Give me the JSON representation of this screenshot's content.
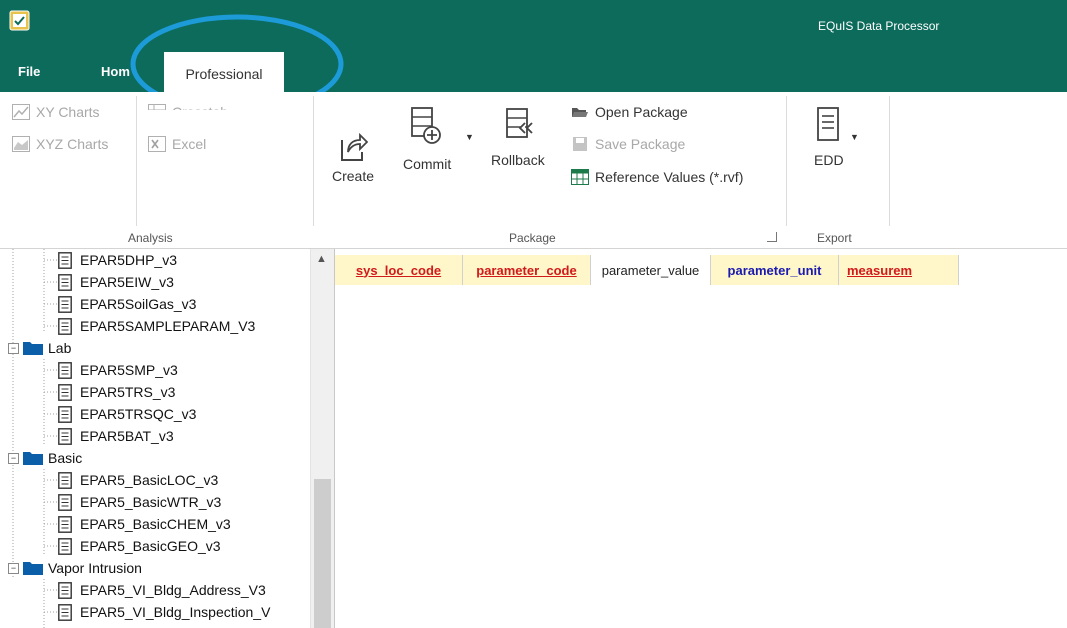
{
  "app": {
    "title": "EQuIS Data Processor"
  },
  "tabs": {
    "file": "File",
    "home": "Hom",
    "professional": "Professional"
  },
  "ribbon": {
    "analysis": {
      "label": "Analysis",
      "xy_charts": "XY Charts",
      "xyz_charts": "XYZ Charts",
      "crosstab": "Crosstab",
      "excel": "Excel"
    },
    "package": {
      "label": "Package",
      "create": "Create",
      "commit": "Commit",
      "rollback": "Rollback",
      "open_package": "Open Package",
      "save_package": "Save Package",
      "reference_values": "Reference Values (*.rvf)"
    },
    "export": {
      "label": "Export",
      "edd": "EDD"
    }
  },
  "tree": {
    "rows": [
      {
        "type": "leaf",
        "label": "EPAR5DHP_v3"
      },
      {
        "type": "leaf",
        "label": "EPAR5EIW_v3"
      },
      {
        "type": "leaf",
        "label": "EPAR5SoilGas_v3"
      },
      {
        "type": "leaf",
        "label": "EPAR5SAMPLEPARAM_V3"
      },
      {
        "type": "folder",
        "label": "Lab"
      },
      {
        "type": "leaf",
        "label": "EPAR5SMP_v3"
      },
      {
        "type": "leaf",
        "label": "EPAR5TRS_v3"
      },
      {
        "type": "leaf",
        "label": "EPAR5TRSQC_v3"
      },
      {
        "type": "leaf",
        "label": "EPAR5BAT_v3"
      },
      {
        "type": "folder",
        "label": "Basic"
      },
      {
        "type": "leaf",
        "label": "EPAR5_BasicLOC_v3"
      },
      {
        "type": "leaf",
        "label": "EPAR5_BasicWTR_v3"
      },
      {
        "type": "leaf",
        "label": "EPAR5_BasicCHEM_v3"
      },
      {
        "type": "leaf",
        "label": "EPAR5_BasicGEO_v3"
      },
      {
        "type": "folder",
        "label": "Vapor Intrusion"
      },
      {
        "type": "leaf",
        "label": "EPAR5_VI_Bldg_Address_V3"
      },
      {
        "type": "leaf",
        "label": "EPAR5_VI_Bldg_Inspection_V"
      }
    ]
  },
  "grid": {
    "columns": [
      {
        "label": "sys_loc_code",
        "style": "req"
      },
      {
        "label": "parameter_code",
        "style": "req"
      },
      {
        "label": "parameter_value",
        "style": "opt"
      },
      {
        "label": "parameter_unit",
        "style": "blue"
      },
      {
        "label": "measurem",
        "style": "req"
      }
    ]
  }
}
